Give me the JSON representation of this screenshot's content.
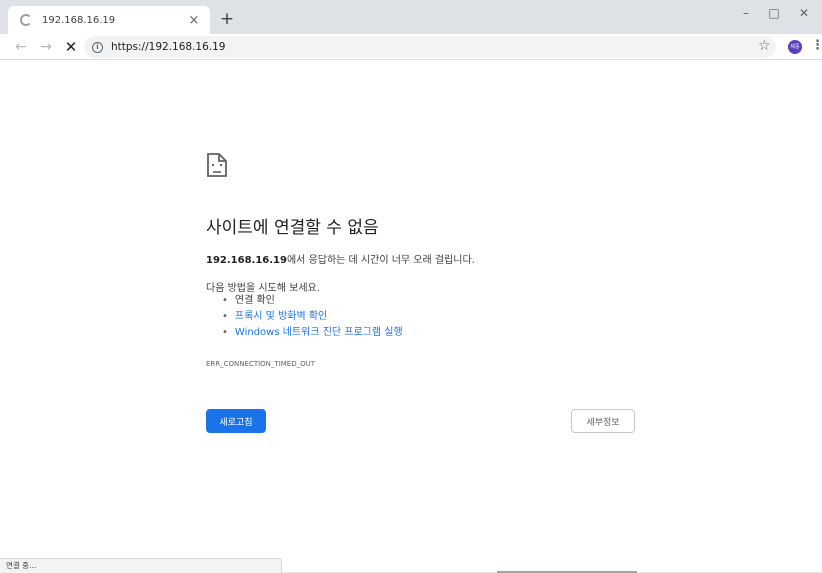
{
  "tab": {
    "title": "192.168.16.19",
    "close": "×"
  },
  "new_tab": "+",
  "window_controls": {
    "minimize": "–",
    "maximize": "□",
    "close": "✕"
  },
  "toolbar": {
    "back": "←",
    "forward": "→",
    "stop": "✕",
    "info": "i",
    "url": "https://192.168.16.19",
    "star": "☆",
    "avatar_text": "제중",
    "menu": "⋮"
  },
  "error": {
    "icon": "sad-page-icon",
    "title": "사이트에 연결할 수 없음",
    "host": "192.168.16.19",
    "summary_rest": "에서 응답하는 데 시간이 너무 오래 걸립니다.",
    "suggest_heading": "다음 방법을 시도해 보세요.",
    "suggestions": [
      "연결 확인",
      "프록시 및 방화벽 확인",
      "Windows 네트워크 진단 프로그램 실행"
    ],
    "code": "ERR_CONNECTION_TIMED_OUT"
  },
  "buttons": {
    "reload": "새로고침",
    "details": "세부정보"
  },
  "status": "연결 중..."
}
